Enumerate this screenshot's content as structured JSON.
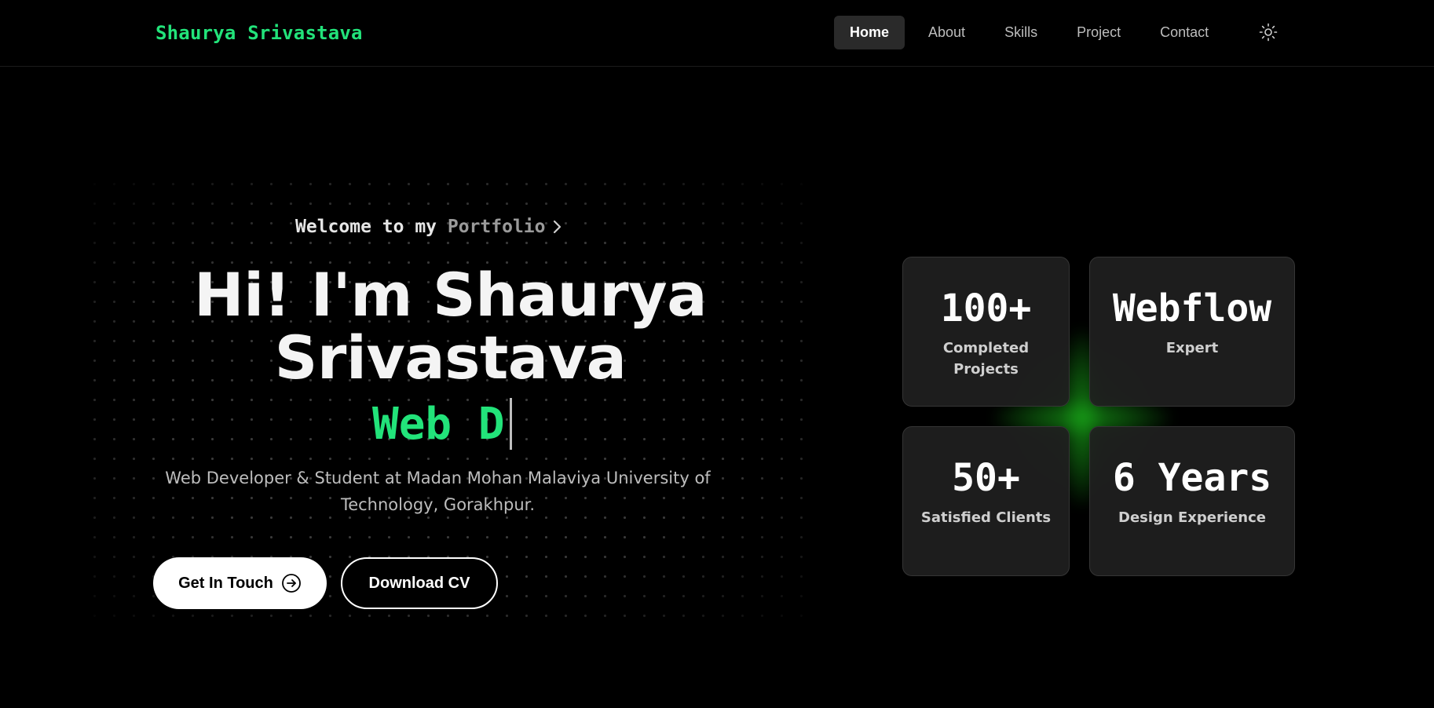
{
  "header": {
    "brand": "Shaurya Srivastava",
    "nav": [
      {
        "label": "Home",
        "active": true
      },
      {
        "label": "About",
        "active": false
      },
      {
        "label": "Skills",
        "active": false
      },
      {
        "label": "Project",
        "active": false
      },
      {
        "label": "Contact",
        "active": false
      }
    ],
    "theme_toggle_icon": "sun-icon"
  },
  "hero": {
    "welcome_bold": "Welcome to my ",
    "welcome_fade": "Portfolio",
    "welcome_icon": "chevron-right-icon",
    "title_line1": "Hi! I'm Shaurya",
    "title_line2": "Srivastava",
    "typed_text": "Web D",
    "tagline": "Web Developer & Student at Madan Mohan Malaviya University of Technology, Gorakhpur.",
    "primary_button": "Get In Touch",
    "primary_button_icon": "arrow-right-circle-icon",
    "secondary_button": "Download CV"
  },
  "stats": [
    {
      "value": "100+",
      "label": "Completed Projects"
    },
    {
      "value": "Webflow",
      "label": "Expert"
    },
    {
      "value": "50+",
      "label": "Satisfied Clients"
    },
    {
      "value": "6 Years",
      "label": "Design Experience"
    }
  ],
  "colors": {
    "accent": "#22e37a",
    "background": "#000000",
    "card": "#202020",
    "glow": "#1ab41a"
  }
}
